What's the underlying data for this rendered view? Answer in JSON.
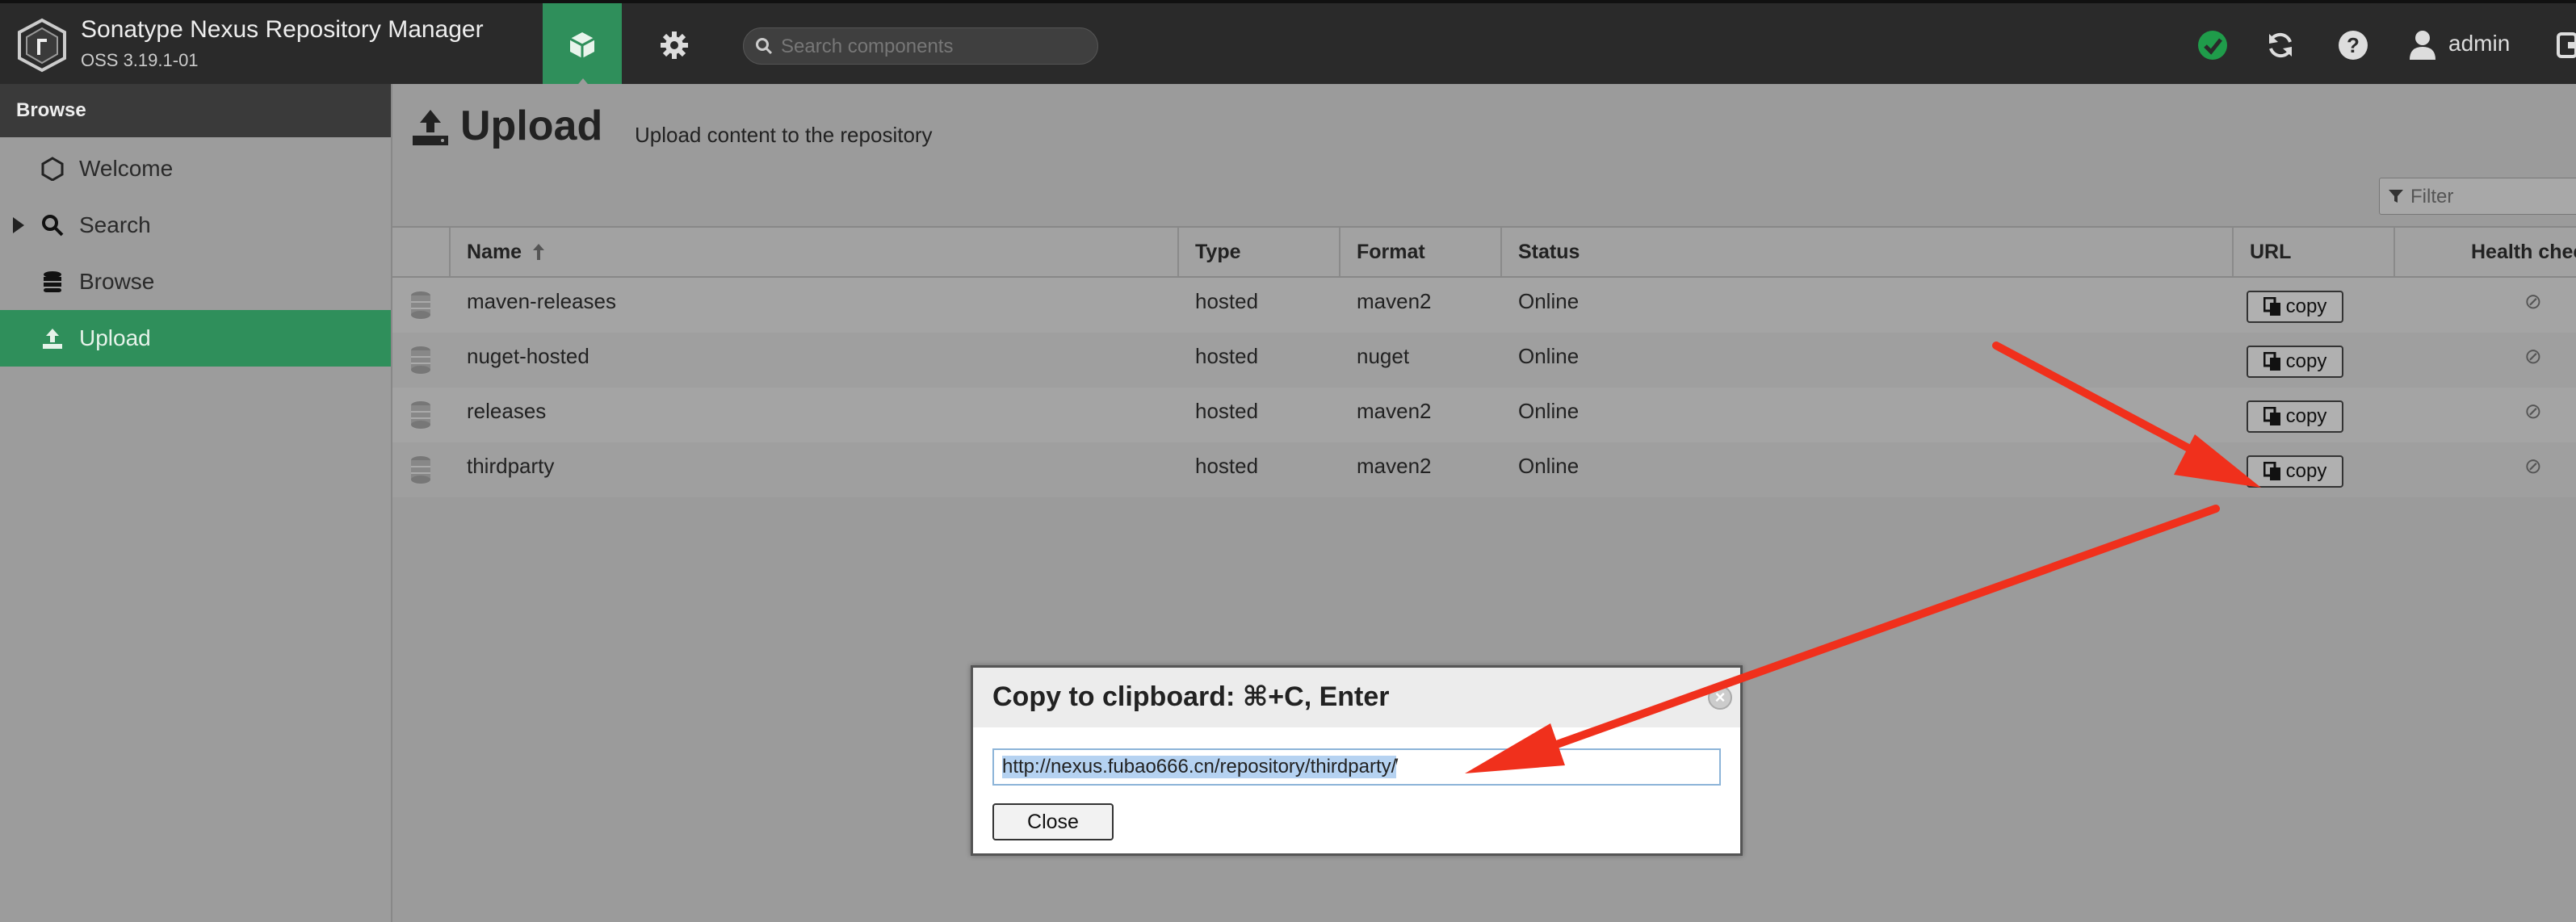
{
  "header": {
    "app_title": "Sonatype Nexus Repository Manager",
    "app_version": "OSS 3.19.1-01",
    "search_placeholder": "Search components",
    "user_name": "admin"
  },
  "sidebar": {
    "title": "Browse",
    "items": [
      {
        "label": "Welcome",
        "icon": "hexagon-icon"
      },
      {
        "label": "Search",
        "icon": "search-icon"
      },
      {
        "label": "Browse",
        "icon": "database-icon"
      },
      {
        "label": "Upload",
        "icon": "upload-icon"
      }
    ]
  },
  "main": {
    "title": "Upload",
    "subtitle": "Upload content to the repository",
    "filter_placeholder": "Filter",
    "columns": {
      "name": "Name",
      "type": "Type",
      "format": "Format",
      "status": "Status",
      "url": "URL",
      "health": "Health check"
    },
    "copy_label": "copy",
    "rows": [
      {
        "name": "maven-releases",
        "type": "hosted",
        "format": "maven2",
        "status": "Online"
      },
      {
        "name": "nuget-hosted",
        "type": "hosted",
        "format": "nuget",
        "status": "Online"
      },
      {
        "name": "releases",
        "type": "hosted",
        "format": "maven2",
        "status": "Online"
      },
      {
        "name": "thirdparty",
        "type": "hosted",
        "format": "maven2",
        "status": "Online"
      }
    ]
  },
  "modal": {
    "title": "Copy to clipboard: ⌘+C, Enter",
    "url": "http://nexus.fubao666.cn/repository/thirdparty/",
    "close_label": "Close"
  },
  "colors": {
    "accent": "#2f8f5b",
    "header_bg": "#2a2a2a",
    "annotation_arrow": "#f0301c",
    "status_ok": "#1f9c4a"
  }
}
